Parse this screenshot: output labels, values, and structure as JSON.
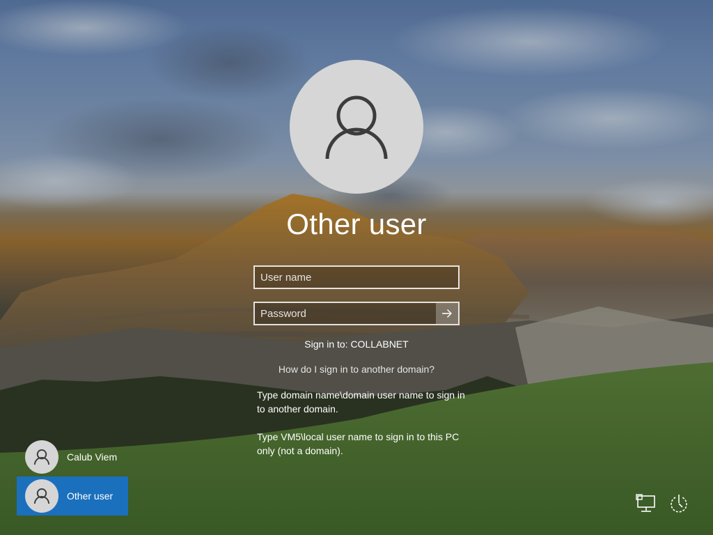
{
  "login": {
    "user_title": "Other user",
    "username_placeholder": "User name",
    "password_placeholder": "Password",
    "sign_in_to": "Sign in to: COLLABNET",
    "help_link": "How do I sign in to another domain?",
    "help_text_1": "Type domain name\\domain user name to sign in to another domain.",
    "help_text_2": "Type VM5\\local user name to sign in to this PC only (not a domain)."
  },
  "users": [
    {
      "label": "Calub Viem",
      "selected": false
    },
    {
      "label": "Other user",
      "selected": true
    }
  ],
  "icons": {
    "avatar": "user-icon",
    "submit": "arrow-right-icon",
    "network": "network-icon",
    "power": "power-icon"
  },
  "colors": {
    "selected_tile": "#1b70bd",
    "avatar_bg": "#d6d6d6",
    "avatar_glyph": "#3c3c3c"
  }
}
